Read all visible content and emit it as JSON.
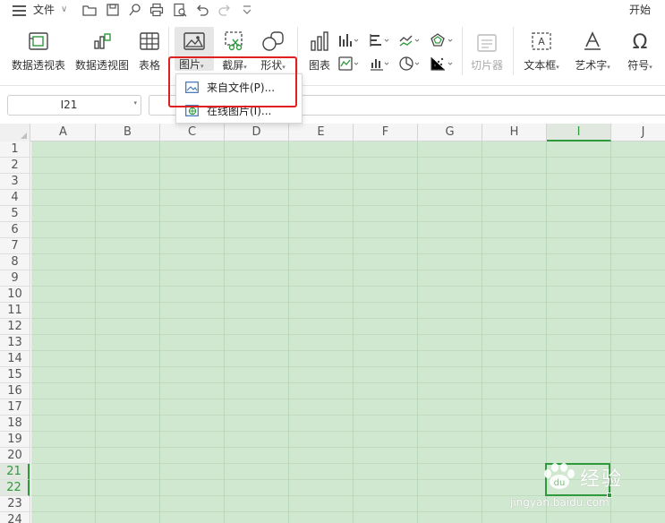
{
  "menubar": {
    "file_label": "文件",
    "caret": "∨",
    "start_label": "开始"
  },
  "ribbon": {
    "pivot_table": "数据透视表",
    "pivot_chart": "数据透视图",
    "table": "表格",
    "picture": "图片",
    "screenshot": "截屏",
    "shape": "形状",
    "chart": "图表",
    "slicer": "切片器",
    "textbox": "文本框",
    "wordart": "艺术字",
    "symbol": "符号",
    "dd_caret": "▾"
  },
  "dropdown": {
    "from_file": "来自文件(P)...",
    "online_picture": "在线图片(I)..."
  },
  "namebox": {
    "value": "I21"
  },
  "grid": {
    "columns": [
      "A",
      "B",
      "C",
      "D",
      "E",
      "F",
      "G",
      "H",
      "I",
      "J"
    ],
    "active_column": "I",
    "rows": [
      "1",
      "2",
      "3",
      "4",
      "5",
      "6",
      "7",
      "8",
      "9",
      "10",
      "11",
      "12",
      "13",
      "14",
      "15",
      "16",
      "17",
      "18",
      "19",
      "20",
      "21",
      "22",
      "23",
      "24"
    ],
    "active_rows": [
      "21",
      "22"
    ]
  },
  "watermark": {
    "text": "经验",
    "url": "jingyan.baidu.com"
  },
  "colors": {
    "cell_bg": "#cfe8cf",
    "accent_green": "#2f9a3d",
    "highlight_red": "#e02020"
  }
}
